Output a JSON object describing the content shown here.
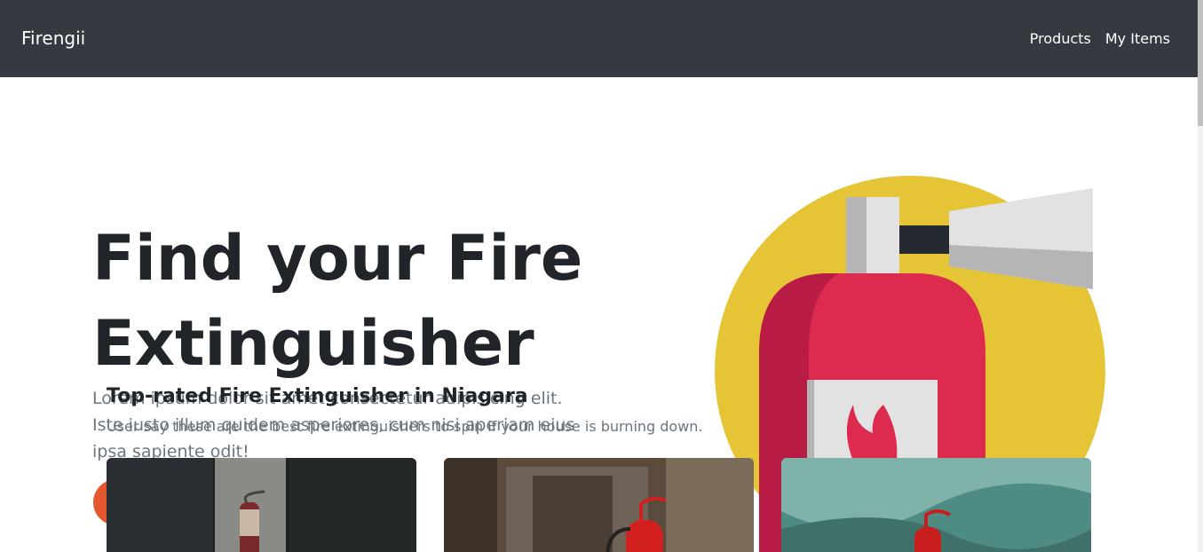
{
  "navbar": {
    "brand": "Firengii",
    "links": [
      {
        "label": "Products"
      },
      {
        "label": "My Items"
      }
    ],
    "bg_color": "#343a40"
  },
  "hero": {
    "title": "Find your Fire Extinguisher",
    "text": "Lorem ipsum dolor sit amet consectetur adipisicing elit. Iste iusto illum quidem asperiores, cum nisi aperiam eius ipsa sapiente odit!",
    "button_color": "#e4572e"
  },
  "products_section": {
    "heading": "Top-rated Fire Extinguisher in Niagara",
    "subheading": "User say these are the best fire extinguishers to spin if your house is burning down."
  },
  "illustration": {
    "icon": "fire-extinguisher-icon",
    "colors": {
      "circle": "#e5c535",
      "body": "#dc2b4f",
      "body_shade": "#b81c45",
      "metal": "#e2e2e2",
      "metal_shade": "#b5b5b5",
      "handle": "#252a30"
    }
  },
  "cards": [
    {
      "image": "wall-mounted-extinguisher-photo"
    },
    {
      "image": "hallway-extinguisher-photo"
    },
    {
      "image": "teal-background-extinguisher-photo"
    }
  ]
}
